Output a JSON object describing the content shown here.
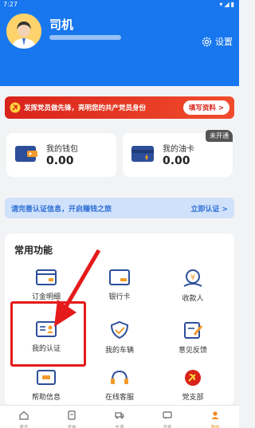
{
  "status_bar": {
    "time": "7:27",
    "icons": "▾◢▮"
  },
  "header": {
    "username": "司机",
    "settings_label": "设置"
  },
  "party_banner": {
    "text": "发挥党员做先锋，亮明您的共产党员身份",
    "button": "填写资料 >"
  },
  "wallet": {
    "label": "我的钱包",
    "value": "0.00"
  },
  "fuel_card": {
    "label": "我的油卡",
    "value": "0.00",
    "badge": "未开通"
  },
  "verify_bar": {
    "text": "请完善认证信息，开启赚钱之旅",
    "link": "立即认证 >"
  },
  "functions": {
    "title": "常用功能",
    "items": [
      {
        "label": "订金明细",
        "icon": "order-detail-icon"
      },
      {
        "label": "银行卡",
        "icon": "bank-card-icon"
      },
      {
        "label": "收款人",
        "icon": "payee-icon"
      },
      {
        "label": "我的认证",
        "icon": "certification-icon"
      },
      {
        "label": "我的车辆",
        "icon": "vehicle-shield-icon"
      },
      {
        "label": "意见反馈",
        "icon": "feedback-icon"
      },
      {
        "label": "帮助信息",
        "icon": "help-icon"
      },
      {
        "label": "在线客服",
        "icon": "customer-service-icon"
      },
      {
        "label": "党支部",
        "icon": "party-branch-icon"
      }
    ]
  },
  "tabbar": {
    "items": [
      {
        "label": "首页",
        "icon": "home-icon"
      },
      {
        "label": "货单",
        "icon": "orders-icon"
      },
      {
        "label": "车源",
        "icon": "truck-icon"
      },
      {
        "label": "消息",
        "icon": "message-icon"
      },
      {
        "label": "我的",
        "icon": "profile-icon"
      }
    ],
    "active_index": 4
  },
  "colors": {
    "header": "#1877ee",
    "accent": "#f08a1c",
    "party_red": "#d8231a",
    "highlight": "#e51a1a"
  }
}
